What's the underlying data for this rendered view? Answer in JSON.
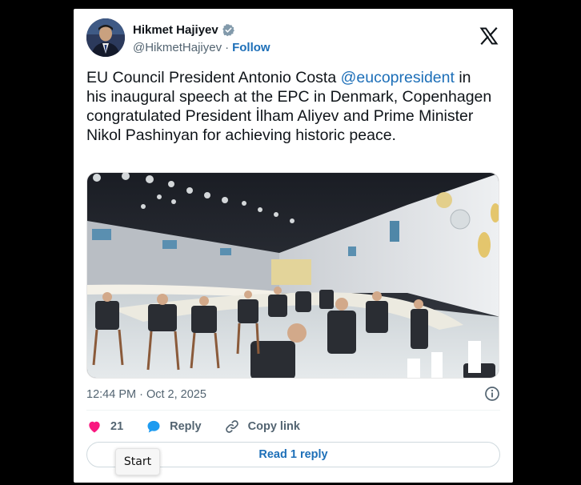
{
  "author": {
    "name": "Hikmet Hajiyev",
    "handle": "@HikmetHajiyev",
    "separator": "·",
    "follow_label": "Follow"
  },
  "tweet": {
    "text_before": "EU Council President Antonio Costa ",
    "mention": "@eucopresident",
    "text_after": " in his inaugural speech at the EPC in Denmark, Copenhagen congratulated President İlham Aliyev and Prime Minister Nikol Pashinyan for achieving historic peace.",
    "timestamp": "12:44 PM · Oct 2, 2025"
  },
  "actions": {
    "like_count": "21",
    "reply_label": "Reply",
    "copy_link_label": "Copy link"
  },
  "read_replies_label": "Read 1 reply",
  "tooltip": "Start",
  "icons": {
    "verified": "verified-badge-icon",
    "logo": "x-logo-icon",
    "info": "info-icon",
    "like": "heart-icon",
    "reply": "reply-bubble-icon",
    "link": "link-icon"
  },
  "colors": {
    "link_blue": "#1d6fb8",
    "heart": "#f91880",
    "reply_bubble": "#1d9bf0",
    "muted": "#536471"
  }
}
